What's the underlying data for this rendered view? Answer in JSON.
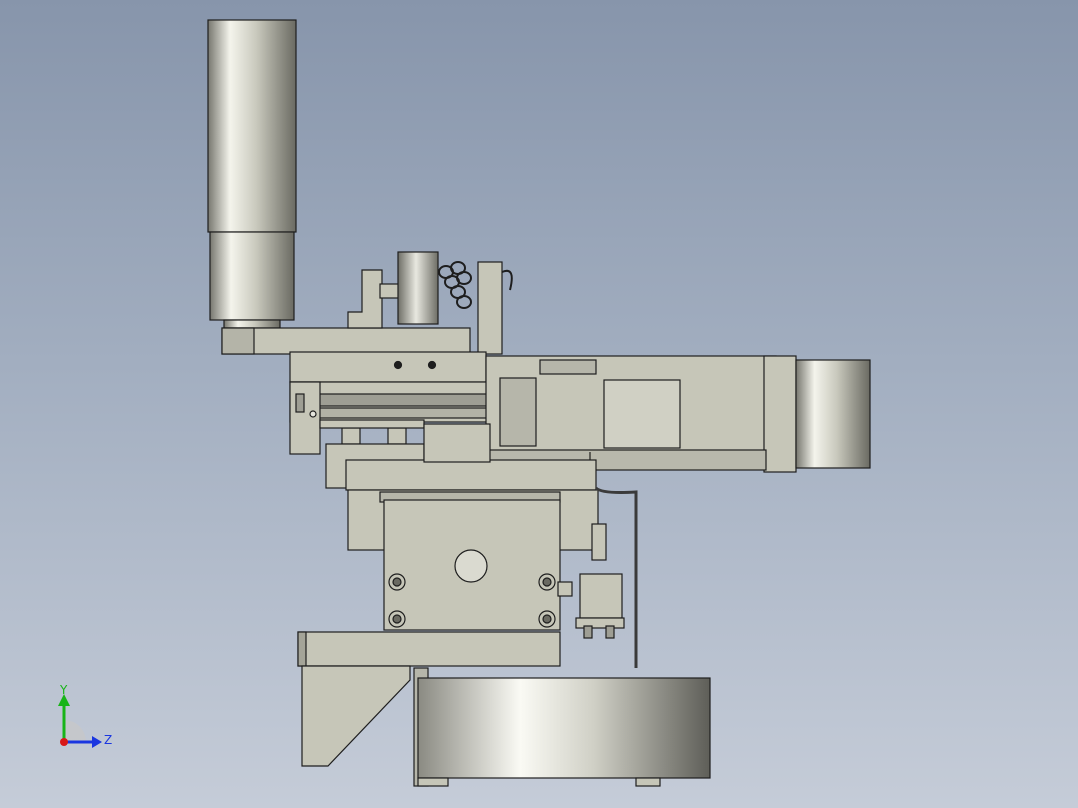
{
  "viewport": {
    "background_top": "#8795ab",
    "background_bottom": "#c5ccd8"
  },
  "model": {
    "fill_body": "#c6c6b8",
    "fill_dark": "#8e8e84",
    "edge_color": "#1e1e1e",
    "metal_light": "#f2f2ea",
    "metal_dark": "#5f5f58"
  },
  "triad": {
    "y_label": "Y",
    "z_label": "Z",
    "y_color": "#18b418",
    "z_color": "#1a36e0",
    "x_color": "#d81818"
  }
}
